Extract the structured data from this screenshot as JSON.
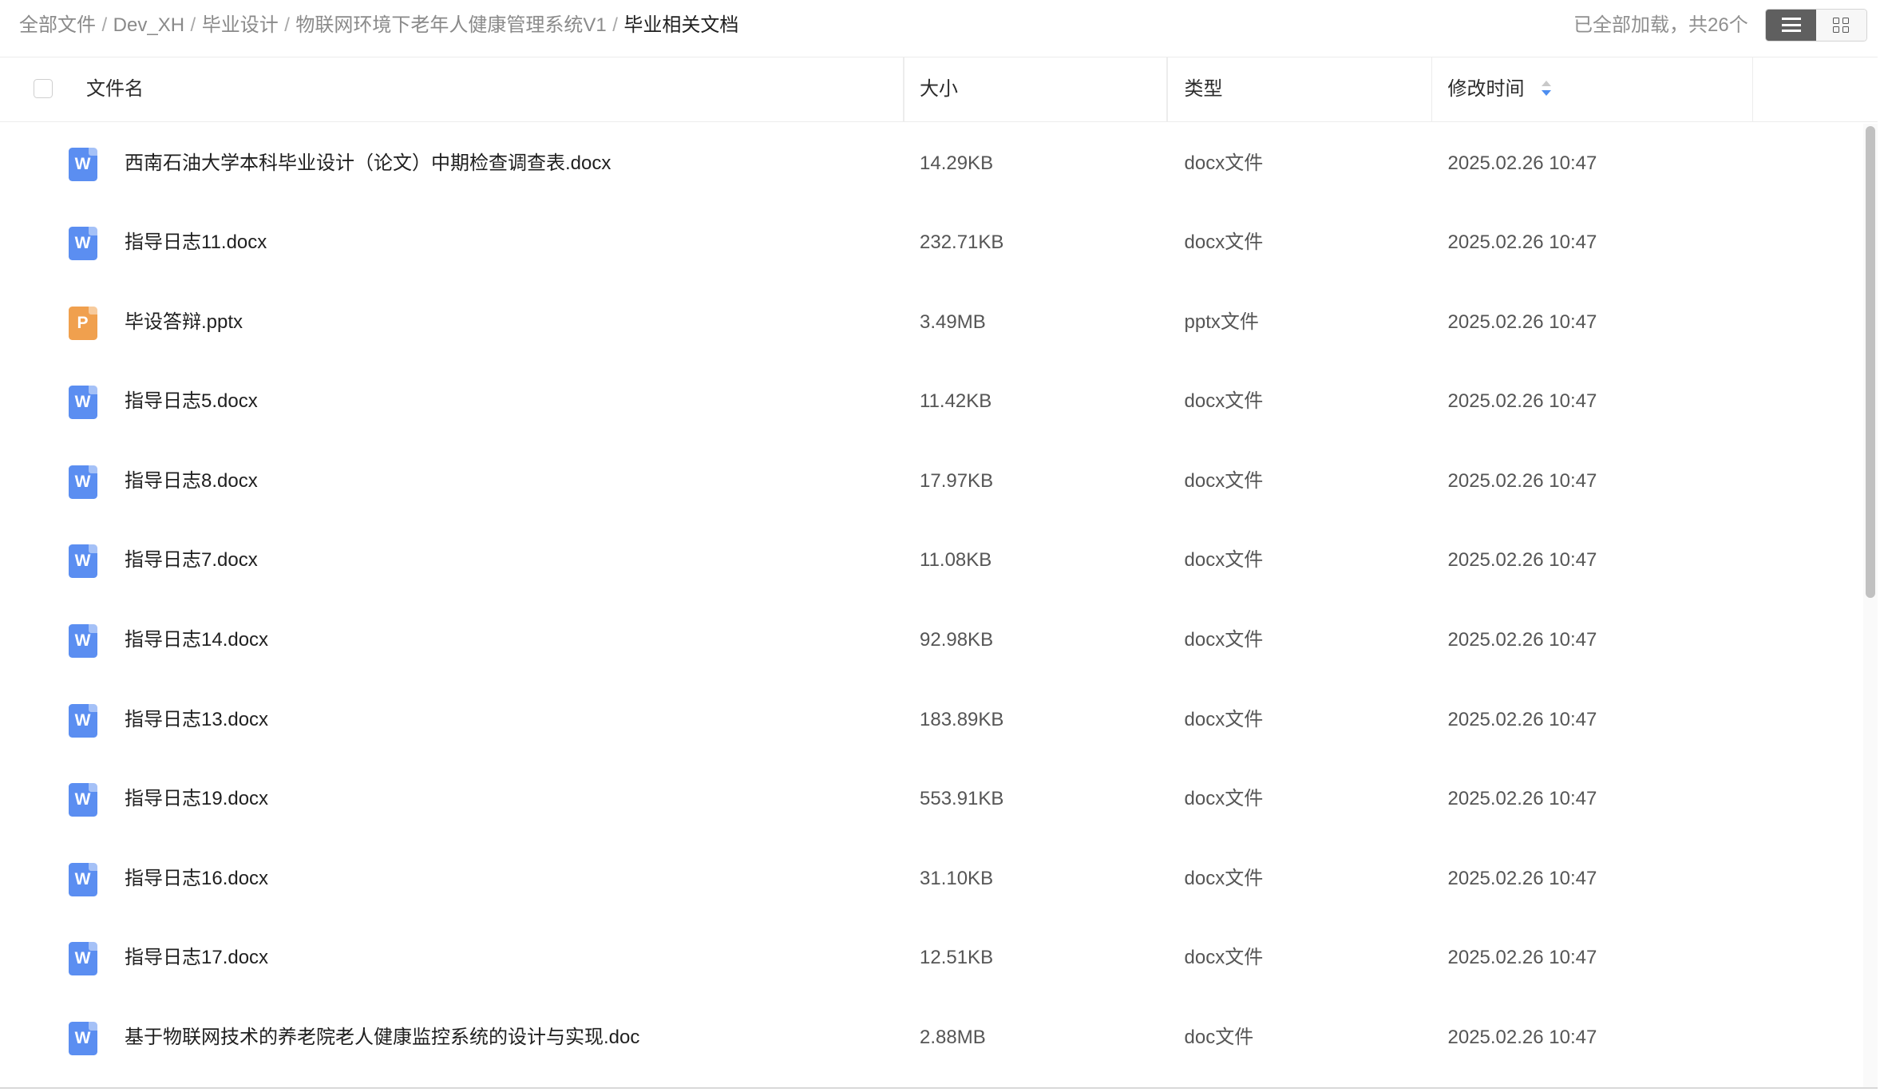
{
  "breadcrumb": {
    "items": [
      "全部文件",
      "Dev_XH",
      "毕业设计",
      "物联网环境下老年人健康管理系统V1",
      "毕业相关文档"
    ],
    "separator": "/"
  },
  "load_status": "已全部加载，共26个",
  "view_toggle": {
    "active": "list-view",
    "options": [
      "list-view",
      "grid-view"
    ]
  },
  "table": {
    "columns": {
      "name": "文件名",
      "size": "大小",
      "type": "类型",
      "modified": "修改时间"
    },
    "sort": {
      "column": "modified",
      "direction": "descending"
    },
    "rows": [
      {
        "name": "西南石油大学本科毕业设计（论文）中期检查调查表.docx",
        "size": "14.29KB",
        "type": "docx文件",
        "modified": "2025.02.26 10:47",
        "icon": "word-file-icon",
        "icon_letter": "W"
      },
      {
        "name": "指导日志11.docx",
        "size": "232.71KB",
        "type": "docx文件",
        "modified": "2025.02.26 10:47",
        "icon": "word-file-icon",
        "icon_letter": "W"
      },
      {
        "name": "毕设答辩.pptx",
        "size": "3.49MB",
        "type": "pptx文件",
        "modified": "2025.02.26 10:47",
        "icon": "powerpoint-file-icon",
        "icon_letter": "P"
      },
      {
        "name": "指导日志5.docx",
        "size": "11.42KB",
        "type": "docx文件",
        "modified": "2025.02.26 10:47",
        "icon": "word-file-icon",
        "icon_letter": "W"
      },
      {
        "name": "指导日志8.docx",
        "size": "17.97KB",
        "type": "docx文件",
        "modified": "2025.02.26 10:47",
        "icon": "word-file-icon",
        "icon_letter": "W"
      },
      {
        "name": "指导日志7.docx",
        "size": "11.08KB",
        "type": "docx文件",
        "modified": "2025.02.26 10:47",
        "icon": "word-file-icon",
        "icon_letter": "W"
      },
      {
        "name": "指导日志14.docx",
        "size": "92.98KB",
        "type": "docx文件",
        "modified": "2025.02.26 10:47",
        "icon": "word-file-icon",
        "icon_letter": "W"
      },
      {
        "name": "指导日志13.docx",
        "size": "183.89KB",
        "type": "docx文件",
        "modified": "2025.02.26 10:47",
        "icon": "word-file-icon",
        "icon_letter": "W"
      },
      {
        "name": "指导日志19.docx",
        "size": "553.91KB",
        "type": "docx文件",
        "modified": "2025.02.26 10:47",
        "icon": "word-file-icon",
        "icon_letter": "W"
      },
      {
        "name": "指导日志16.docx",
        "size": "31.10KB",
        "type": "docx文件",
        "modified": "2025.02.26 10:47",
        "icon": "word-file-icon",
        "icon_letter": "W"
      },
      {
        "name": "指导日志17.docx",
        "size": "12.51KB",
        "type": "docx文件",
        "modified": "2025.02.26 10:47",
        "icon": "word-file-icon",
        "icon_letter": "W"
      },
      {
        "name": "基于物联网技术的养老院老人健康监控系统的设计与实现.doc",
        "size": "2.88MB",
        "type": "doc文件",
        "modified": "2025.02.26 10:47",
        "icon": "word-file-icon",
        "icon_letter": "W"
      }
    ]
  },
  "colors": {
    "word_icon": "#5b8ef1",
    "ppt_icon": "#f0a04e",
    "sort_active": "#4d8ef0",
    "toggle_active": "#5f5f5f"
  }
}
